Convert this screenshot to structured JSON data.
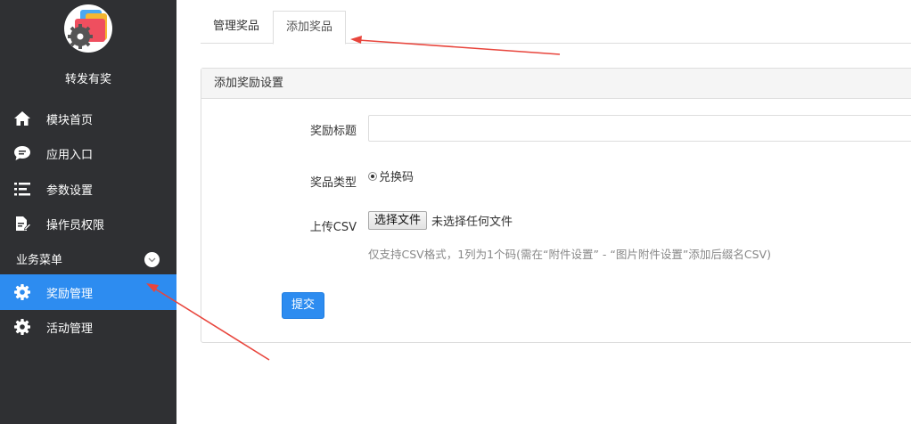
{
  "sidebar": {
    "module_name": "转发有奖",
    "items": [
      {
        "label": "模块首页",
        "icon": "home-icon"
      },
      {
        "label": "应用入口",
        "icon": "chat-bubble-icon"
      },
      {
        "label": "参数设置",
        "icon": "list-settings-icon"
      },
      {
        "label": "操作员权限",
        "icon": "document-edit-icon"
      }
    ],
    "section_title": "业务菜单",
    "section_items": [
      {
        "label": "奖励管理",
        "icon": "gear-icon",
        "active": true
      },
      {
        "label": "活动管理",
        "icon": "gear-icon",
        "active": false
      }
    ]
  },
  "tabs": [
    {
      "label": "管理奖品",
      "active": false
    },
    {
      "label": "添加奖品",
      "active": true
    }
  ],
  "panel": {
    "title": "添加奖励设置",
    "fields": {
      "reward_title": {
        "label": "奖励标题",
        "value": "",
        "placeholder": ""
      },
      "prize_type": {
        "label": "奖品类型",
        "option": "兑换码",
        "selected": true
      },
      "upload_csv": {
        "label": "上传CSV",
        "button": "选择文件",
        "status": "未选择任何文件",
        "hint": "仅支持CSV格式，1列为1个码(需在“附件设置” - “图片附件设置”添加后缀名CSV)"
      }
    },
    "submit_label": "提交"
  },
  "colors": {
    "sidebar_bg": "#2f3033",
    "accent": "#2d8cf0",
    "annotation_arrow": "#e8453c"
  }
}
